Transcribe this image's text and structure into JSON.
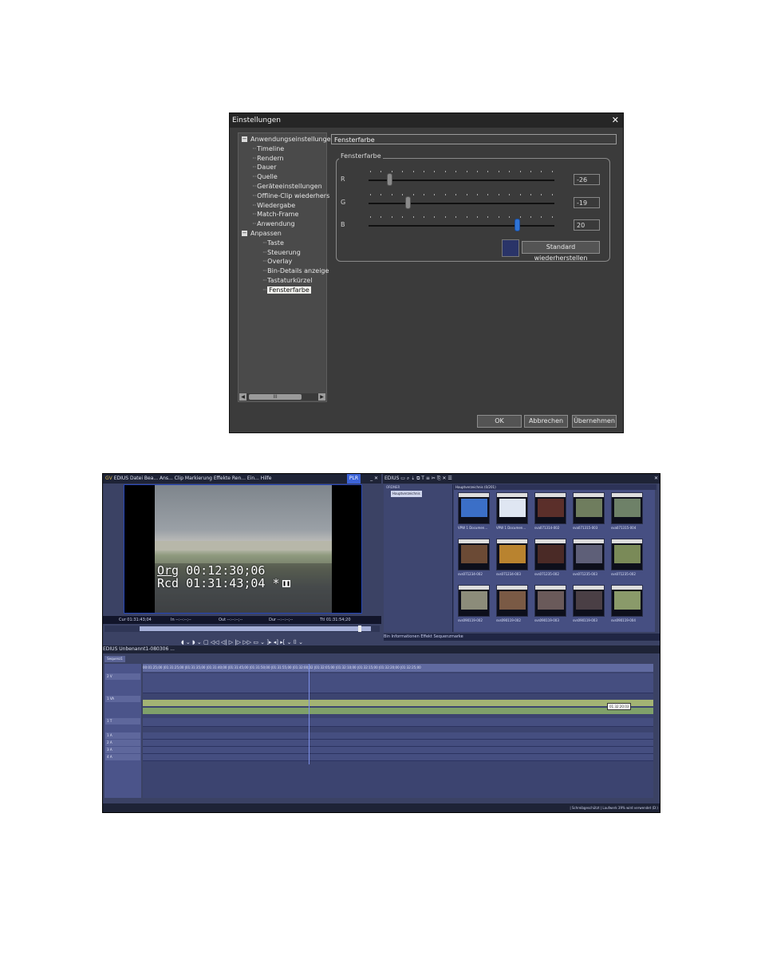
{
  "dialog": {
    "title": "Einstellungen",
    "tree": [
      {
        "label": "Anwendungseinstellungen",
        "level": 0,
        "box": "−"
      },
      {
        "label": "Timeline",
        "level": 1
      },
      {
        "label": "Rendern",
        "level": 1
      },
      {
        "label": "Dauer",
        "level": 1
      },
      {
        "label": "Quelle",
        "level": 1
      },
      {
        "label": "Geräteeinstellungen",
        "level": 1
      },
      {
        "label": "Offline-Clip wiederhers",
        "level": 1
      },
      {
        "label": "Wiedergabe",
        "level": 1
      },
      {
        "label": "Match-Frame",
        "level": 1
      },
      {
        "label": "Anwendung",
        "level": 1
      },
      {
        "label": "Anpassen",
        "level": 0,
        "box": "−"
      },
      {
        "label": "Taste",
        "level": 2
      },
      {
        "label": "Steuerung",
        "level": 2
      },
      {
        "label": "Overlay",
        "level": 2
      },
      {
        "label": "Bin-Details anzeige",
        "level": 2
      },
      {
        "label": "Tastaturkürzel",
        "level": 2
      },
      {
        "label": "Fensterfarbe",
        "level": 2,
        "selected": true
      }
    ],
    "panel_title": "Fensterfarbe",
    "group_label": "Fensterfarbe",
    "channels": [
      {
        "name": "R",
        "value": "-26",
        "level": 0.11
      },
      {
        "name": "G",
        "value": "-19",
        "level": 0.21
      },
      {
        "name": "B",
        "value": "20",
        "level": 0.8
      }
    ],
    "swatch_color": "#2a3468",
    "reset_label": "Standard wiederherstellen",
    "ok_label": "OK",
    "cancel_label": "Abbrechen",
    "apply_label": "Übernehmen",
    "close_glyph": "✕",
    "scroll_thumb_glyph": "III"
  },
  "edius": {
    "preview_title": "EDIUS  Datei  Bea...  Ans...  Clip  Markierung  Effekte  Ren...  Ein...  Hilfe",
    "preview_badge": "PLR",
    "org_label": "Org",
    "org_tc": "00:12:30;06",
    "rcd_label": "Rcd",
    "rcd_tc": "01:31:43;04",
    "rcd_mark": "*",
    "info_cur": "Cur 01:31:43;04",
    "info_in": "In --:--:--;--",
    "info_out": "Out --:--:--;--",
    "info_dur": "Dur --:--:--;--",
    "info_ttl": "Ttl 01:31:54;20",
    "transport": "◖ ⌄ ◗ ⌄    ▢  ◁◁  ◁|  ▷  |▷  ▷▷  ▭ ⌄  ]▸  ◂]  ▸[ ⌄  ⌷ ⌄",
    "bin_title": "EDIUS  ▭  ⌕  ⇣  ⧉  T  ≡  ✂  ⎘  ✕  ☰",
    "bin_root": "Hauptverzeichnis",
    "bin_folder": "Hauptverzeichnis (0/201)",
    "bin_tree_head": "ORDNER",
    "clips": [
      {
        "name": "VPW 1 Documen...",
        "color": "#3b6fc7"
      },
      {
        "name": "VPW 1 Documen...",
        "color": "#dfe6f2"
      },
      {
        "name": "sva071314-002",
        "color": "#5b2f2a"
      },
      {
        "name": "sva071315-003",
        "color": "#6f7d5e"
      },
      {
        "name": "sva071315-004",
        "color": "#6e8168"
      },
      {
        "name": "svs071234-002",
        "color": "#6b4a35"
      },
      {
        "name": "svs071234-003",
        "color": "#b9832f"
      },
      {
        "name": "svs071235-002",
        "color": "#4a2a26"
      },
      {
        "name": "svs071235-003",
        "color": "#5e5f78"
      },
      {
        "name": "svs071235-002",
        "color": "#7a8a58"
      },
      {
        "name": "svs090119-002",
        "color": "#8c8c7a"
      },
      {
        "name": "svs090119-002",
        "color": "#7a5a45"
      },
      {
        "name": "svs090119-003",
        "color": "#6a5a5a"
      },
      {
        "name": "svs090119-003",
        "color": "#4a3f45"
      },
      {
        "name": "svs090119-004",
        "color": "#8a9a6a"
      }
    ],
    "bin_tabs": "Bin    Informationen    Effekt    Sequenzmarke",
    "tl_title": "EDIUS  Unbenannt1-080306 ...",
    "tl_tab": "Sequenz1",
    "ruler": "00:01:25;00    |01:31:25;00    |01:31:35;00    |01:31:40;00    |01:31:45;00    |01:31:50;00    |01:31:55;00    |01:32:00;02    |01:32:05;00    |01:32:10;00    |01:32:15;00    |01:32:20;00    |01:32:25;00",
    "tracks": [
      "2 V",
      "1 VA",
      "1 T",
      "1 A",
      "2 A",
      "3 A",
      "4 A"
    ],
    "tc_badge": "01:32:20;03",
    "status": "| Schreibgeschützt    | Laufwerk 39% wird verwendet (D:)"
  }
}
